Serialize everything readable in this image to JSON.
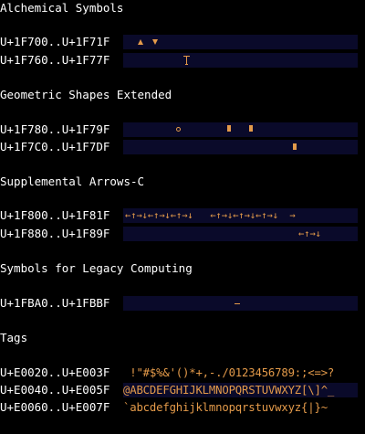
{
  "colors": {
    "background": "#000000",
    "text": "#ffffff",
    "glyph": "#e39a4a",
    "glyph_strip": "#0a0a2a"
  },
  "blocks": [
    {
      "title": "Alchemical Symbols",
      "rows": [
        {
          "range": "U+1F700..U+1F71F"
        },
        {
          "range": "U+1F760..U+1F77F"
        }
      ]
    },
    {
      "title": "Geometric Shapes Extended",
      "rows": [
        {
          "range": "U+1F780..U+1F79F"
        },
        {
          "range": "U+1F7C0..U+1F7DF"
        }
      ]
    },
    {
      "title": "Supplemental Arrows-C",
      "rows": [
        {
          "range": "U+1F800..U+1F81F",
          "glyphs": "←↑→↓←↑→↓←↑→↓   ←↑→↓←↑→↓←↑→↓  →"
        },
        {
          "range": "U+1F880..U+1F89F",
          "glyphs": "←↑→↓"
        }
      ]
    },
    {
      "title": "Symbols for Legacy Computing",
      "rows": [
        {
          "range": "U+1FBA0..U+1FBBF"
        }
      ]
    },
    {
      "title": "Tags",
      "rows": [
        {
          "range": "U+E0020..U+E003F",
          "glyphs": " !\"#$%&'()*+,-./0123456789:;<=>?"
        },
        {
          "range": "U+E0040..U+E005F",
          "glyphs": "@ABCDEFGHIJKLMNOPQRSTUVWXYZ[\\]^_"
        },
        {
          "range": "U+E0060..U+E007F",
          "glyphs": "`abcdefghijklmnopqrstuvwxyz{|}~"
        }
      ]
    }
  ]
}
